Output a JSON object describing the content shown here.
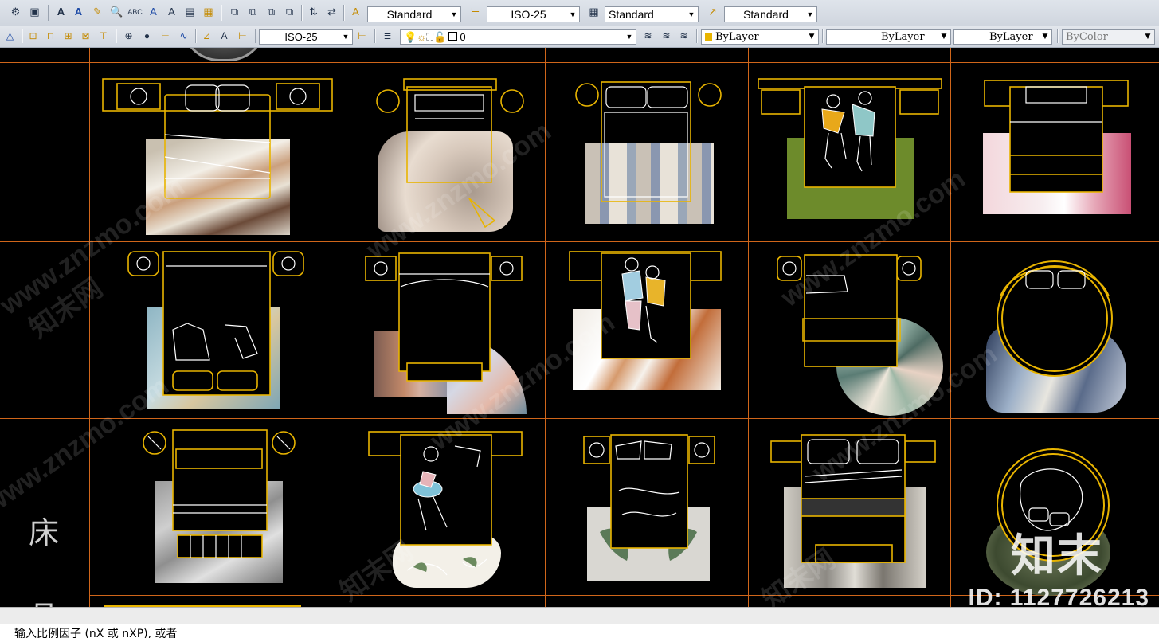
{
  "toolbar_top": {
    "text_style": "Standard",
    "dim_style": "ISO-25",
    "table_style": "Standard",
    "mleader_style": "Standard"
  },
  "toolbar_second": {
    "dim_style": "ISO-25",
    "layer": "0",
    "color": "ByLayer",
    "linetype": "ByLayer",
    "lineweight": "ByLayer",
    "plot_style": "ByColor"
  },
  "drawing": {
    "side_label_1": "床",
    "side_label_2": "品",
    "watermark_text": "www.znzmo.com",
    "watermark_site": "知末网",
    "logo_text": "知末",
    "id_text": "ID: 1127726213"
  },
  "command_line": {
    "prompt": "输入比例因子 (nX 或 nXP), 或者"
  },
  "colors": {
    "grid": "#d0661a",
    "outline": "#e8b400",
    "linework": "#ffffff"
  }
}
